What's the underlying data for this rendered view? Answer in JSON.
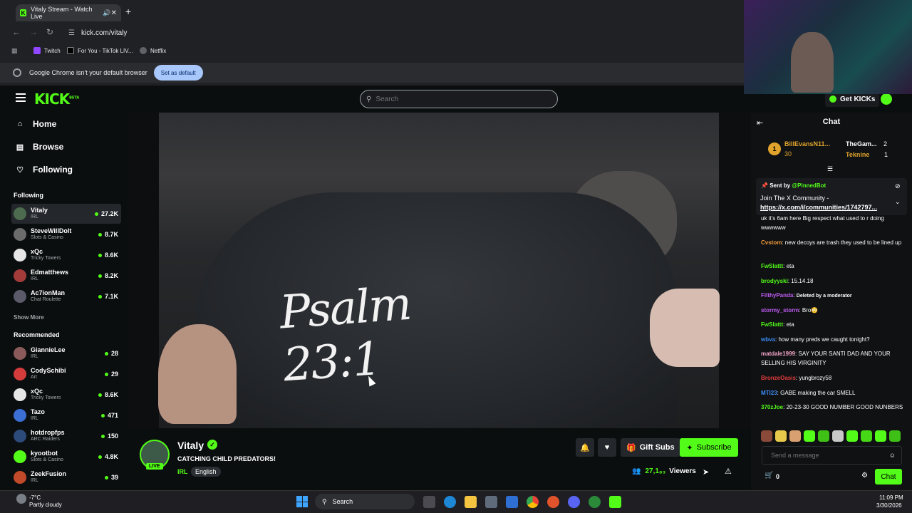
{
  "browser": {
    "tab_title": "Vitaly Stream - Watch Live",
    "url": "kick.com/vitaly",
    "bookmarks": [
      {
        "label": "Twitch",
        "color": "#9146ff"
      },
      {
        "label": "For You - TikTok LIV...",
        "color": "#000000"
      },
      {
        "label": "Netflix",
        "color": "#e50914"
      }
    ],
    "notice_text": "Google Chrome isn't your default browser",
    "set_default_label": "Set as default"
  },
  "kick": {
    "logo": "KICK",
    "logo_badge": "BETA",
    "search_placeholder": "Search",
    "get_kicks_label": "Get KICKs",
    "accent": "#53fc18"
  },
  "sidebar": {
    "nav": [
      {
        "label": "Home",
        "icon": "home-icon"
      },
      {
        "label": "Browse",
        "icon": "browse-icon"
      },
      {
        "label": "Following",
        "icon": "heart-icon"
      }
    ],
    "following_title": "Following",
    "following": [
      {
        "name": "Vitaly",
        "category": "IRL",
        "viewers": "27.2K",
        "color": "#4d6b4f"
      },
      {
        "name": "SteveWillDoIt",
        "category": "Slots & Casino",
        "viewers": "8.7K",
        "color": "#6b6b6b"
      },
      {
        "name": "xQc",
        "category": "Tricky Towers",
        "viewers": "8.6K",
        "color": "#e6e6e6"
      },
      {
        "name": "Edmatthews",
        "category": "IRL",
        "viewers": "8.2K",
        "color": "#a33b3b"
      },
      {
        "name": "Ac7ionMan",
        "category": "Chat Roulette",
        "viewers": "7.1K",
        "color": "#5a5a6a"
      }
    ],
    "show_more": "Show More",
    "recommended_title": "Recommended",
    "recommended": [
      {
        "name": "GiannieLee",
        "category": "IRL",
        "viewers": "28",
        "color": "#8a5a5a"
      },
      {
        "name": "CodySchibi",
        "category": "Art",
        "viewers": "29",
        "color": "#d43c3c"
      },
      {
        "name": "xQc",
        "category": "Tricky Towers",
        "viewers": "8.6K",
        "color": "#e6e6e6"
      },
      {
        "name": "Tazo",
        "category": "IRL",
        "viewers": "471",
        "color": "#3b6fd4"
      },
      {
        "name": "hotdropfps",
        "category": "ARC Raiders",
        "viewers": "150",
        "color": "#2c4a7a"
      },
      {
        "name": "kyootbot",
        "category": "Slots & Casino",
        "viewers": "4.8K",
        "color": "#53fc18"
      },
      {
        "name": "ZeekFusion",
        "category": "IRL",
        "viewers": "39",
        "color": "#c04a2a"
      }
    ]
  },
  "video": {
    "overlay_text": "Psalm 23:1"
  },
  "stream": {
    "name": "Vitaly",
    "live_label": "LIVE",
    "title": "CATCHING CHILD PREDATORS!",
    "category": "IRL",
    "tag": "English",
    "gift_label": "Gift Subs",
    "subscribe_label": "Subscribe",
    "viewers": "27,1₈₃",
    "viewers_label": "Viewers"
  },
  "chat": {
    "title": "Chat",
    "gifters": [
      {
        "name": "BillEvansN11...",
        "count": "30"
      },
      {
        "name": "TheGam...",
        "count": "2"
      },
      {
        "name": "Teknine",
        "count": "1"
      }
    ],
    "pinned": {
      "sender_prefix": "Sent by",
      "sender": "@PinnedBot",
      "text": "Join The X Community -",
      "link": "https://x.com/i/communities/1742797..."
    },
    "messages": [
      {
        "user": "",
        "color": "#ffffff",
        "text": "uk it's 6am here Big respect what used to r doing wwwwww"
      },
      {
        "user": "Cvstom",
        "color": "#f59b3b",
        "text": "new decoys are trash they used to be lined up"
      },
      {
        "user": "FwSlattt",
        "color": "#53fc18",
        "text": "eta"
      },
      {
        "user": "brodyyski",
        "color": "#53fc18",
        "text": "15.14.18"
      },
      {
        "user": "FilthyPanda",
        "color": "#c05cf2",
        "text": "Deleted by a moderator"
      },
      {
        "user": "stormy_storm",
        "color": "#c05cf2",
        "text": "Bro😳"
      },
      {
        "user": "FwSlattt",
        "color": "#53fc18",
        "text": "eta"
      },
      {
        "user": "wbva",
        "color": "#3b8cf5",
        "text": "how many preds we caught tonight?"
      },
      {
        "user": "matdale1999",
        "color": "#f5a6c8",
        "text": "SAY YOUR SANTI DAD AND YOUR SELLING HIS VIRGINITY"
      },
      {
        "user": "BronzeOasis",
        "color": "#e23c3c",
        "text": "yungbrozy58"
      },
      {
        "user": "MTI23",
        "color": "#3b8cf5",
        "text": "GABE making the car SMELL"
      },
      {
        "user": "370zJoe",
        "color": "#53fc18",
        "text": "20-23-30 GOOD NUMBER GOOD NUNBERS"
      }
    ],
    "send_placeholder": "Send a message",
    "kicks_count": "0",
    "chat_button": "Chat"
  },
  "taskbar": {
    "weather_temp": "-7°C",
    "weather_desc": "Partly cloudy",
    "search_label": "Search",
    "time": "11:09 PM",
    "date": "3/30/2026"
  }
}
